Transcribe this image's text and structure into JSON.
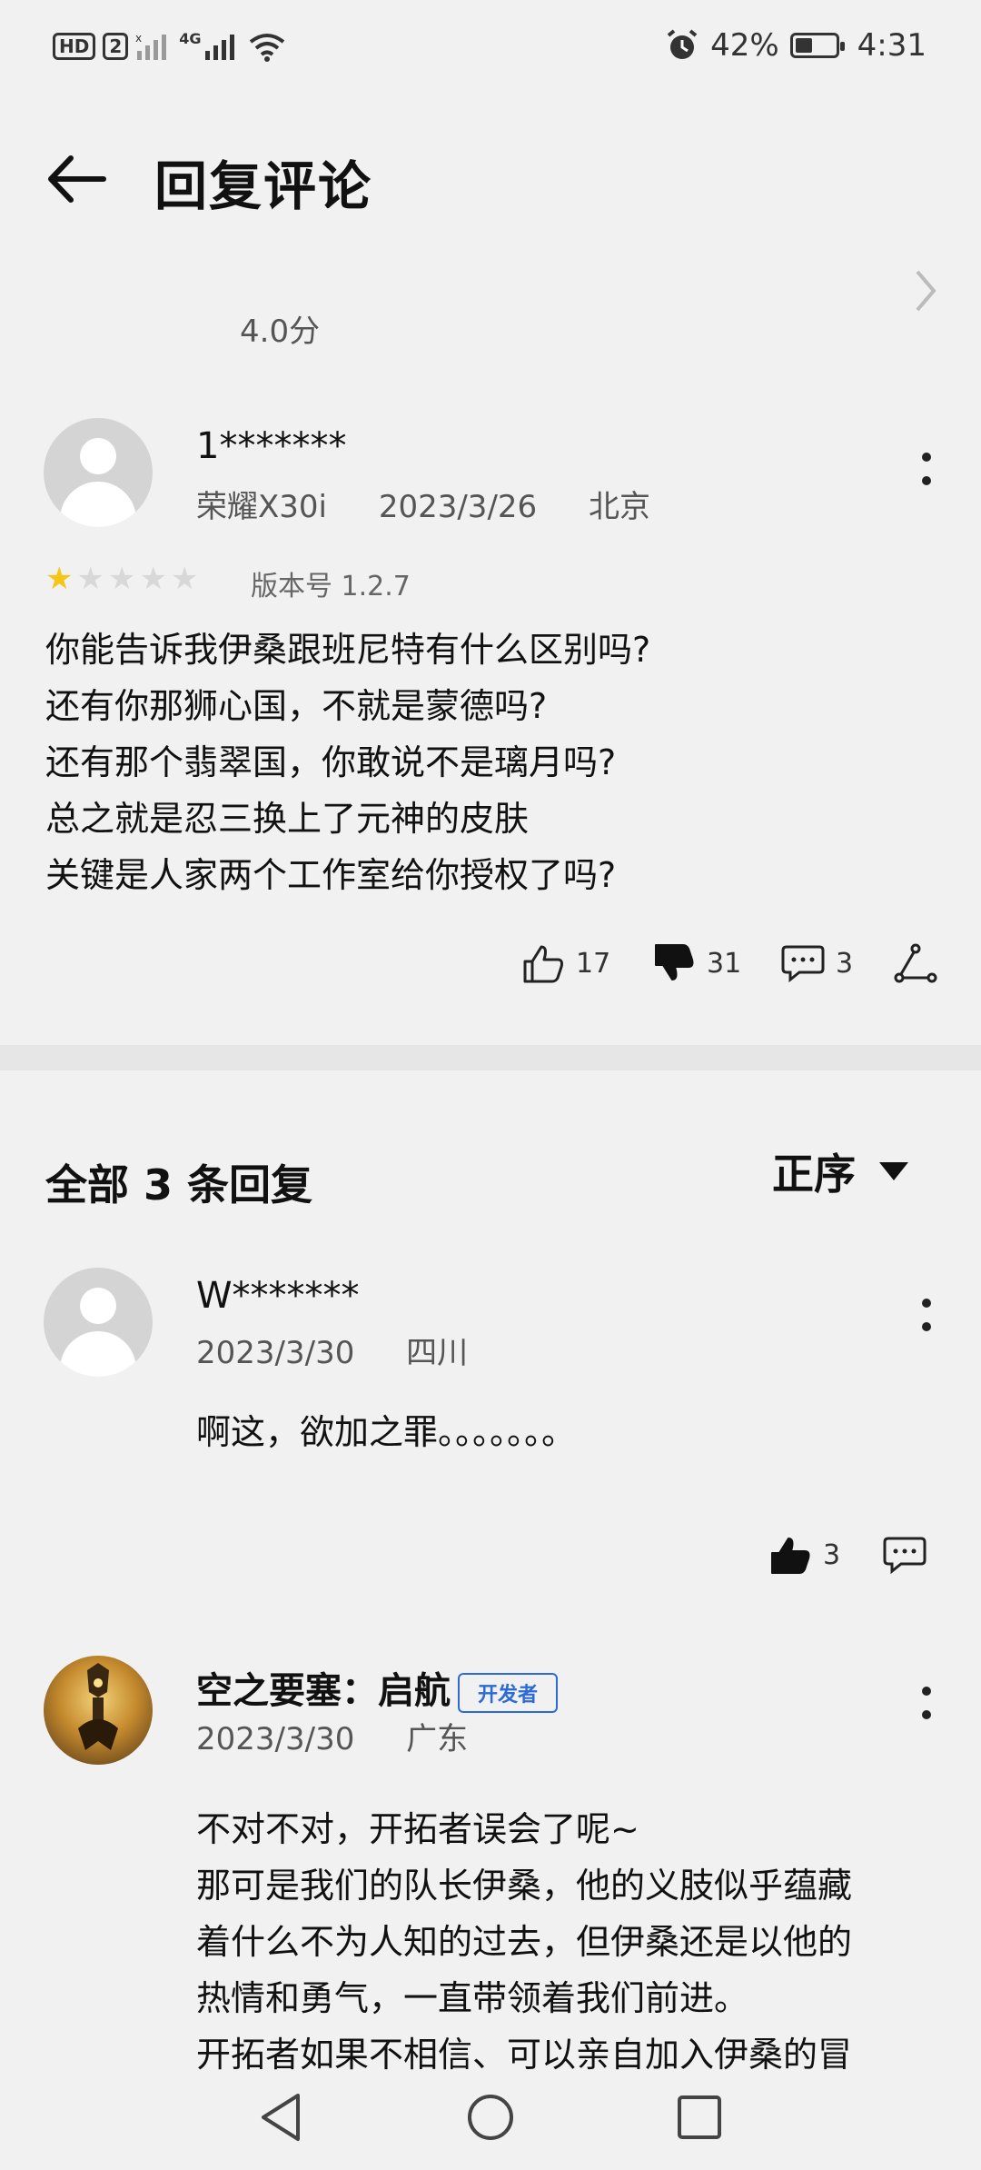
{
  "status_bar": {
    "left": {
      "hd": "HD",
      "sim": "2",
      "net": "4G"
    },
    "right": {
      "battery_text": "42%",
      "battery_level": 0.42,
      "time": "4:31"
    }
  },
  "header": {
    "title": "回复评论"
  },
  "rating": {
    "score": "4.0分"
  },
  "main_comment": {
    "username": "1*******",
    "device": "荣耀X30i",
    "date": "2023/3/26",
    "location": "北京",
    "stars": 1,
    "version": "版本号 1.2.7",
    "text_lines": [
      "你能告诉我伊桑跟班尼特有什么区别吗?",
      "还有你那狮心国，不就是蒙德吗?",
      "还有那个翡翠国，你敢说不是璃月吗?",
      "总之就是忍三换上了元神的皮肤",
      "关键是人家两个工作室给你授权了吗?"
    ],
    "likes": "17",
    "dislikes": "31",
    "comments": "3"
  },
  "replies_section": {
    "title": "全部 3 条回复",
    "sort_label": "正序"
  },
  "replies": [
    {
      "username": "W*******",
      "date": "2023/3/30",
      "location": "四川",
      "text_lines": [
        "啊这，欲加之罪。。。。。。。"
      ],
      "likes": "3"
    },
    {
      "username": "空之要塞：启航",
      "badge": "开发者",
      "date": "2023/3/30",
      "location": "广东",
      "text_lines": [
        "不对不对，开拓者误会了呢~",
        "那可是我们的队长伊桑，他的义肢似乎蕴藏",
        "着什么不为人知的过去，但伊桑还是以他的",
        "热情和勇气，一直带领着我们前进。",
        "开拓者如果不相信、可以亲自加入伊桑的冒"
      ]
    }
  ],
  "icons": {
    "back": "arrow-left-icon",
    "chevron": "chevron-right-icon",
    "more": "more-vertical-icon",
    "like": "thumbs-up-icon",
    "dislike": "thumbs-down-icon",
    "comment": "comment-icon",
    "share": "share-icon",
    "sort": "triangle-down-icon"
  },
  "colors": {
    "star_on": "#f5c518",
    "badge": "#2c6bd6",
    "background": "#f1f1f1"
  }
}
